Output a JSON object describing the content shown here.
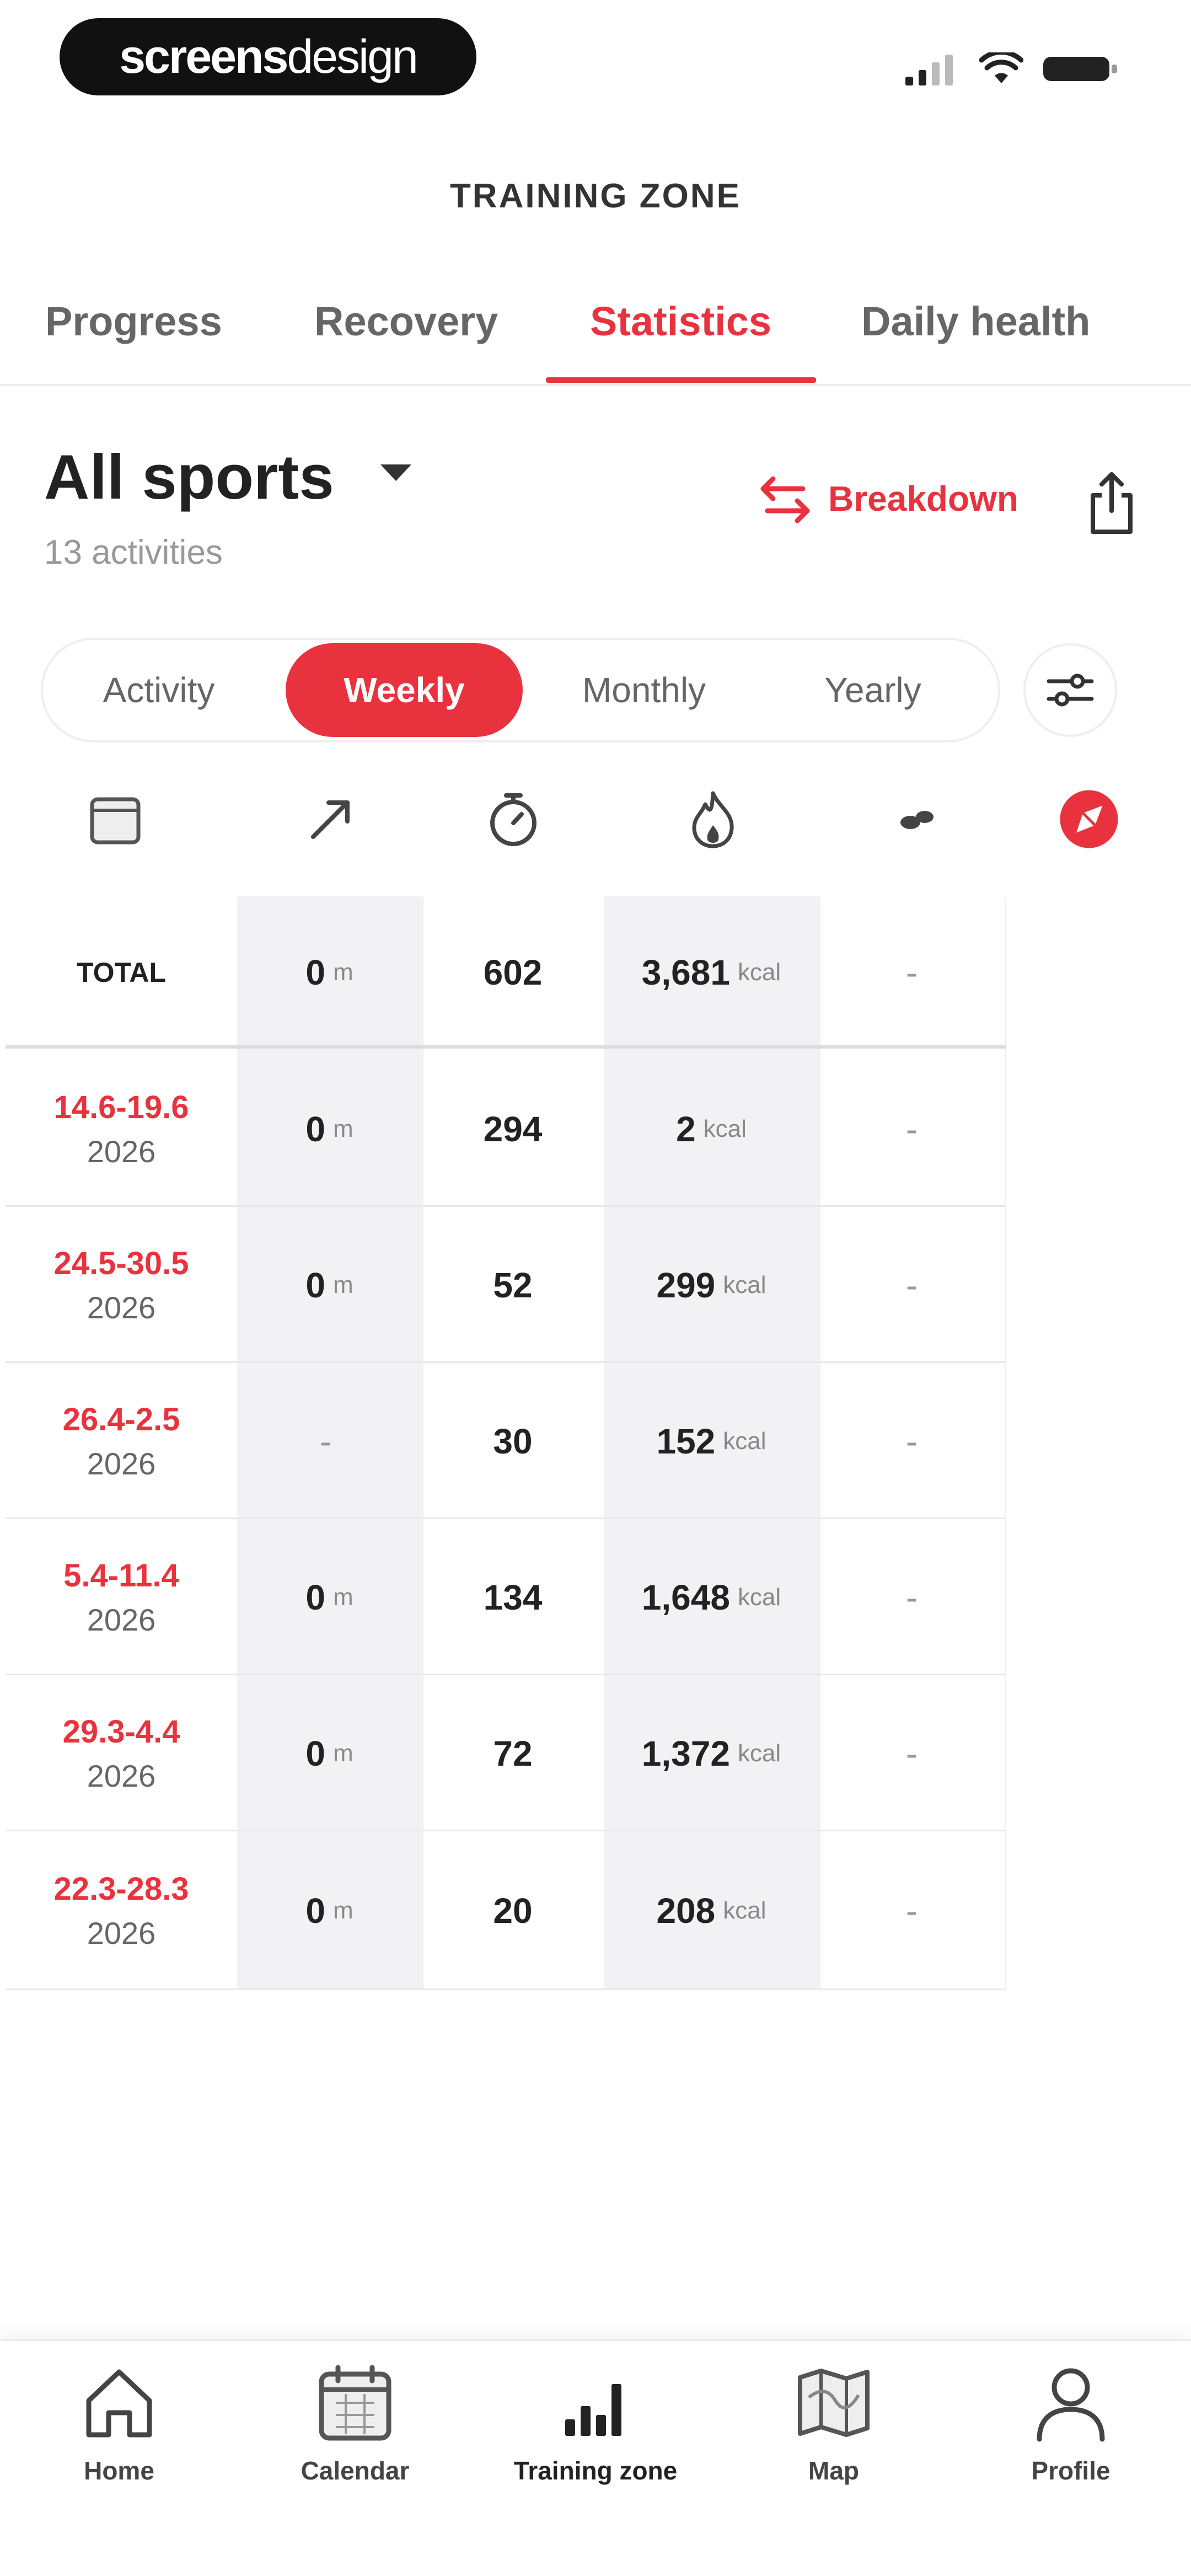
{
  "status_bar": {
    "brand_bold": "screens",
    "brand_light": "design"
  },
  "header": {
    "title": "TRAINING ZONE"
  },
  "tabs": [
    {
      "label": "Progress"
    },
    {
      "label": "Recovery"
    },
    {
      "label": "Statistics",
      "active": true
    },
    {
      "label": "Daily health"
    }
  ],
  "filter": {
    "sport": "All sports",
    "activities": "13 activities",
    "breakdown_label": "Breakdown"
  },
  "segments": [
    {
      "label": "Activity"
    },
    {
      "label": "Weekly",
      "active": true
    },
    {
      "label": "Monthly"
    },
    {
      "label": "Yearly"
    }
  ],
  "column_icons": [
    "calendar-icon",
    "distance-arrow-icon",
    "stopwatch-icon",
    "flame-icon",
    "footsteps-icon",
    "compass-icon"
  ],
  "table": {
    "total": {
      "label": "TOTAL",
      "distance": "0",
      "distance_unit": "m",
      "duration": "602",
      "calories": "3,681",
      "calories_unit": "kcal",
      "extra": "-"
    },
    "rows": [
      {
        "range": "14.6-19.6",
        "year": "2026",
        "distance": "0",
        "distance_unit": "m",
        "duration": "294",
        "calories": "2",
        "calories_unit": "kcal",
        "extra": "-"
      },
      {
        "range": "24.5-30.5",
        "year": "2026",
        "distance": "0",
        "distance_unit": "m",
        "duration": "52",
        "calories": "299",
        "calories_unit": "kcal",
        "extra": "-"
      },
      {
        "range": "26.4-2.5",
        "year": "2026",
        "distance": "-",
        "distance_unit": "",
        "duration": "30",
        "calories": "152",
        "calories_unit": "kcal",
        "extra": "-"
      },
      {
        "range": "5.4-11.4",
        "year": "2026",
        "distance": "0",
        "distance_unit": "m",
        "duration": "134",
        "calories": "1,648",
        "calories_unit": "kcal",
        "extra": "-"
      },
      {
        "range": "29.3-4.4",
        "year": "2026",
        "distance": "0",
        "distance_unit": "m",
        "duration": "72",
        "calories": "1,372",
        "calories_unit": "kcal",
        "extra": "-"
      },
      {
        "range": "22.3-28.3",
        "year": "2026",
        "distance": "0",
        "distance_unit": "m",
        "duration": "20",
        "calories": "208",
        "calories_unit": "kcal",
        "extra": "-"
      }
    ]
  },
  "bottom_nav": [
    {
      "label": "Home",
      "icon": "home-icon"
    },
    {
      "label": "Calendar",
      "icon": "calendar-icon"
    },
    {
      "label": "Training zone",
      "icon": "bar-chart-icon",
      "active": true
    },
    {
      "label": "Map",
      "icon": "map-icon"
    },
    {
      "label": "Profile",
      "icon": "profile-icon"
    }
  ],
  "colors": {
    "accent": "#e8333f",
    "shade": "#f2f2f4"
  }
}
